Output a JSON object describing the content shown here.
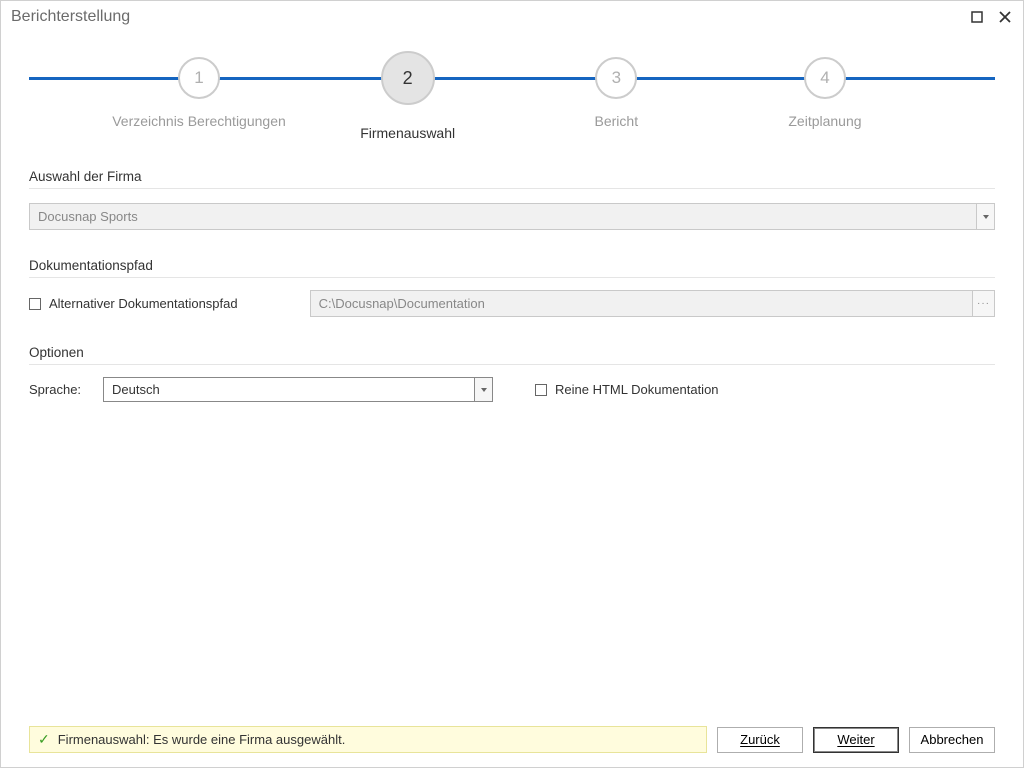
{
  "window": {
    "title": "Berichterstellung"
  },
  "stepper": {
    "active_index": 1,
    "steps": [
      {
        "num": "1",
        "label": "Verzeichnis Berechtigungen"
      },
      {
        "num": "2",
        "label": "Firmenauswahl"
      },
      {
        "num": "3",
        "label": "Bericht"
      },
      {
        "num": "4",
        "label": "Zeitplanung"
      }
    ]
  },
  "section_firma": {
    "title": "Auswahl der Firma",
    "value": "Docusnap Sports"
  },
  "section_doc": {
    "title": "Dokumentationspfad",
    "alt_checkbox_label": "Alternativer Dokumentationspfad",
    "alt_checked": false,
    "path_value": "C:\\Docusnap\\Documentation"
  },
  "section_opts": {
    "title": "Optionen",
    "lang_label": "Sprache:",
    "lang_value": "Deutsch",
    "html_checkbox_label": "Reine HTML Dokumentation",
    "html_checked": false
  },
  "footer": {
    "status": "Firmenauswahl: Es wurde eine Firma ausgewählt.",
    "back": "Zurück",
    "next": "Weiter",
    "cancel": "Abbrechen"
  }
}
